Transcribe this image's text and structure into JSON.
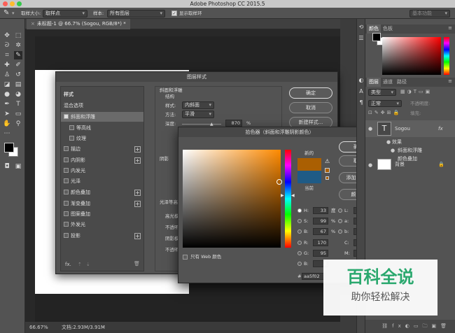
{
  "app": {
    "title": "Adobe Photoshop CC 2015.5"
  },
  "options": {
    "sample_size_label": "取样大小:",
    "sample_size_value": "取样点",
    "sample_label": "样本:",
    "sample_value": "所有图层",
    "show_ring_label": "显示取样环",
    "workspace": "基本功能"
  },
  "document": {
    "tab_label": "未标题-1 @ 66.7% (Sogou, RGB/8*) *",
    "zoom": "66.67%",
    "doc_size": "文档:2.93M/3.91M"
  },
  "layer_style": {
    "title": "图层样式",
    "list_header": "样式",
    "blend_options": "混合选项",
    "items": [
      {
        "label": "斜面和浮雕",
        "checked": true,
        "plus": false,
        "indent": false
      },
      {
        "label": "等高线",
        "checked": false,
        "plus": false,
        "indent": true
      },
      {
        "label": "纹理",
        "checked": false,
        "plus": false,
        "indent": true
      },
      {
        "label": "描边",
        "checked": false,
        "plus": true,
        "indent": false
      },
      {
        "label": "内阴影",
        "checked": false,
        "plus": true,
        "indent": false
      },
      {
        "label": "内发光",
        "checked": false,
        "plus": false,
        "indent": false
      },
      {
        "label": "光泽",
        "checked": false,
        "plus": false,
        "indent": false
      },
      {
        "label": "颜色叠加",
        "checked": false,
        "plus": true,
        "indent": false
      },
      {
        "label": "渐变叠加",
        "checked": false,
        "plus": true,
        "indent": false
      },
      {
        "label": "图案叠加",
        "checked": false,
        "plus": false,
        "indent": false
      },
      {
        "label": "外发光",
        "checked": false,
        "plus": false,
        "indent": false
      },
      {
        "label": "投影",
        "checked": false,
        "plus": true,
        "indent": false
      }
    ],
    "fx_label": "fx.",
    "section_title": "斜面和浮雕",
    "structure_label": "结构",
    "style_label": "样式:",
    "style_value": "内斜面",
    "technique_label": "方法:",
    "technique_value": "平滑",
    "depth_label": "深度:",
    "depth_value": "870",
    "depth_unit": "%",
    "gloss_label": "光泽等高",
    "highlight_label": "高光模",
    "opacity_label": "不透明",
    "shadow_label": "阴影模",
    "opacity2_label": "不透明",
    "shade_label": "阴影",
    "ok": "确定",
    "cancel": "取消",
    "new_style": "新建样式...",
    "preview": "预览"
  },
  "color_picker": {
    "title": "拾色器（斜面和浮雕阴影颜色）",
    "ok": "确定",
    "cancel": "取消",
    "add_swatch": "添加到色板",
    "libraries": "颜色库",
    "new_label": "新的",
    "current_label": "当前",
    "new_color": "#aa5f02",
    "current_color": "#1f5b86",
    "web_only": "只有 Web 颜色",
    "hsb": [
      {
        "key": "H:",
        "value": "33",
        "unit": "度",
        "on": true
      },
      {
        "key": "S:",
        "value": "99",
        "unit": "%",
        "on": false
      },
      {
        "key": "B:",
        "value": "67",
        "unit": "%",
        "on": false
      }
    ],
    "rgb": [
      {
        "key": "R:",
        "value": "170"
      },
      {
        "key": "G:",
        "value": "95"
      },
      {
        "key": "B:",
        "value": "2"
      }
    ],
    "lab": [
      {
        "key": "L:",
        "value": "49"
      },
      {
        "key": "a:",
        "value": "28"
      },
      {
        "key": "b:",
        "value": "63"
      }
    ],
    "cmyk": [
      {
        "key": "C:",
        "value": "41",
        "unit": "%"
      },
      {
        "key": "M:",
        "value": "70",
        "unit": "%"
      }
    ],
    "hex_label": "#",
    "hex": "aa5f02"
  },
  "panels": {
    "color_tab": "颜色",
    "swatches_tab": "色板",
    "layers_tab": "图层",
    "channels_tab": "通道",
    "paths_tab": "路径",
    "kind": "类型",
    "blend_mode": "正常",
    "opacity_label": "不透明度:",
    "fill_label": "填充:",
    "layers": [
      {
        "name": "Sogou",
        "type": "text"
      },
      {
        "name": "效果",
        "type": "effect"
      },
      {
        "name": "斜面和浮雕",
        "type": "effect"
      },
      {
        "name": "颜色叠加",
        "type": "effect"
      },
      {
        "name": "背景",
        "type": "bg"
      }
    ]
  },
  "watermark": {
    "title": "百科全说",
    "subtitle": "助你轻松解决"
  }
}
